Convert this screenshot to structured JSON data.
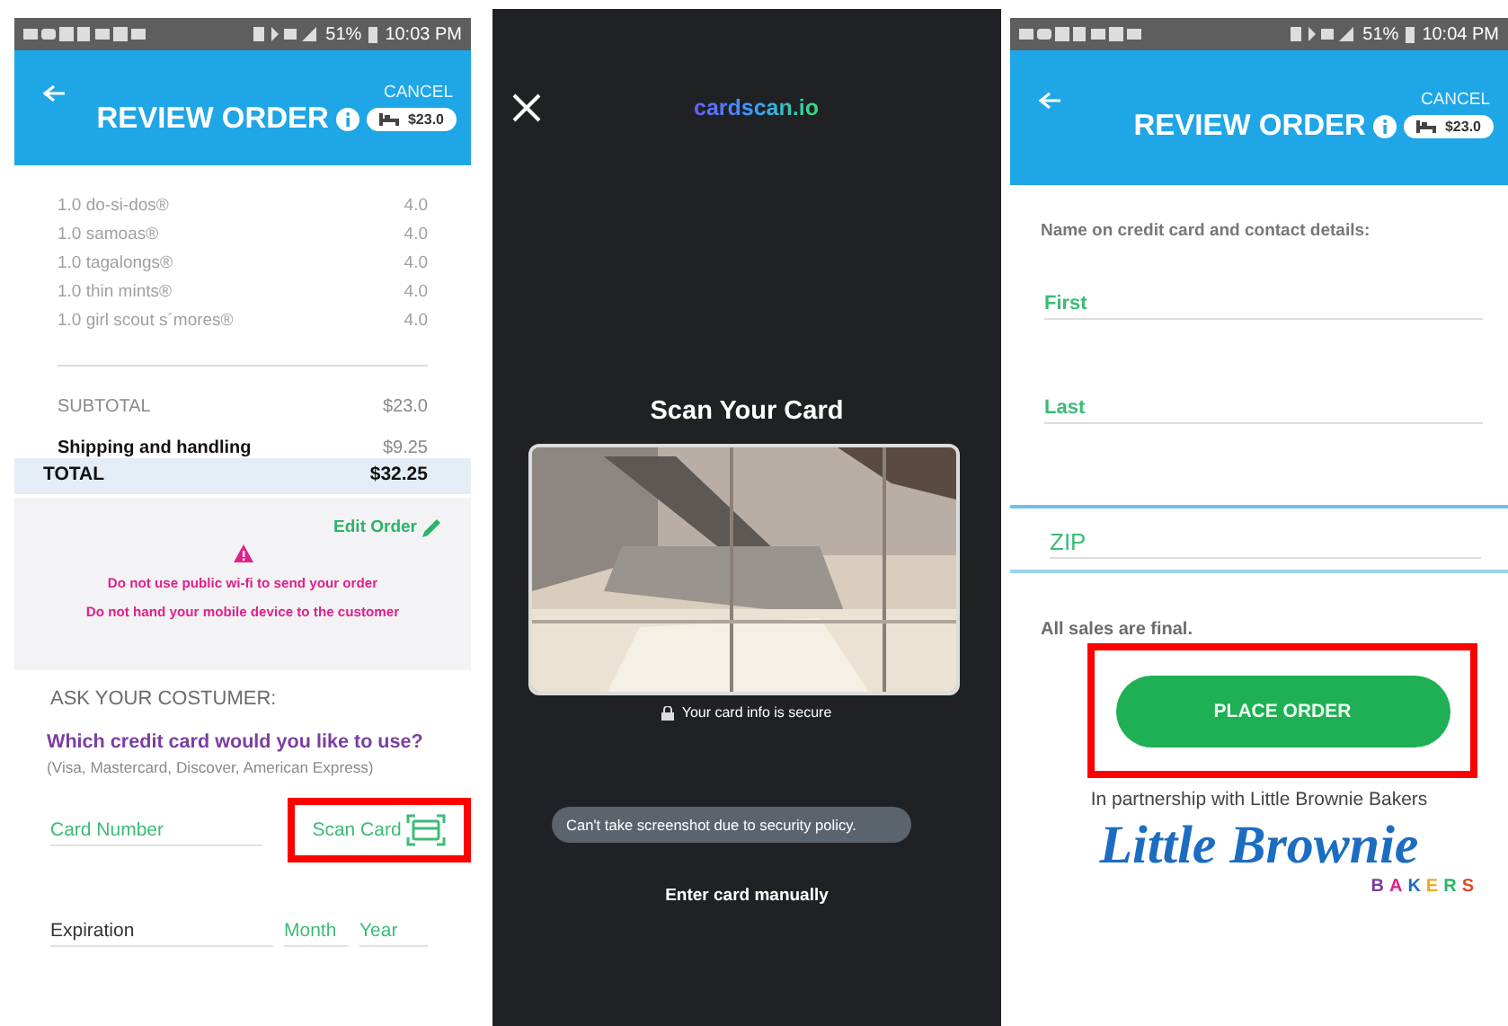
{
  "left_screen": {
    "status_bar": {
      "battery": "51%",
      "time": "10:03 PM"
    },
    "header": {
      "cancel": "CANCEL",
      "title": "REVIEW ORDER",
      "cart_total": "$23.0"
    },
    "items": [
      {
        "name": "1.0 do-si-dos®",
        "price": "4.0"
      },
      {
        "name": "1.0 samoas®",
        "price": "4.0"
      },
      {
        "name": "1.0 tagalongs®",
        "price": "4.0"
      },
      {
        "name": "1.0 thin mints®",
        "price": "4.0"
      },
      {
        "name": "1.0 girl scout s´mores®",
        "price": "4.0"
      }
    ],
    "subtotal": {
      "label": "SUBTOTAL",
      "value": "$23.0"
    },
    "shipping": {
      "label": "Shipping and handling",
      "value": "$9.25"
    },
    "total": {
      "label": "TOTAL",
      "value": "$32.25"
    },
    "edit_order": "Edit Order",
    "warnings": [
      "Do not use public wi-fi to send your order",
      "Do not hand your mobile device to the customer"
    ],
    "ask_label": "ASK YOUR COSTUMER:",
    "question": "Which credit card would you like to use?",
    "card_types": "(Visa, Mastercard, Discover, American Express)",
    "card_number": {
      "placeholder": "Card Number"
    },
    "scan_card": {
      "label": "Scan Card",
      "highlighted": true
    },
    "expiration": {
      "label": "Expiration",
      "month": {
        "placeholder": "Month"
      },
      "year": {
        "placeholder": "Year"
      }
    }
  },
  "scanner_screen": {
    "logo": "cardscan.io",
    "title": "Scan Your Card",
    "secure_note": "Your card info is secure",
    "toast": "Can't take screenshot due to security policy.",
    "manual_link": "Enter card manually"
  },
  "right_screen": {
    "status_bar": {
      "battery": "51%",
      "time": "10:04 PM"
    },
    "header": {
      "cancel": "CANCEL",
      "title": "REVIEW ORDER",
      "cart_total": "$23.0"
    },
    "section_label": "Name on credit card and contact details:",
    "fields": [
      {
        "placeholder": "First"
      },
      {
        "placeholder": "Last"
      }
    ],
    "zip": {
      "placeholder": "ZIP"
    },
    "final_note": "All sales are final.",
    "place_order": {
      "label": "PLACE ORDER",
      "highlighted": true
    },
    "partnership": "In partnership with Little Brownie Bakers",
    "logo": {
      "name": "Little Brownie",
      "subtitle": "BAKERS"
    }
  }
}
